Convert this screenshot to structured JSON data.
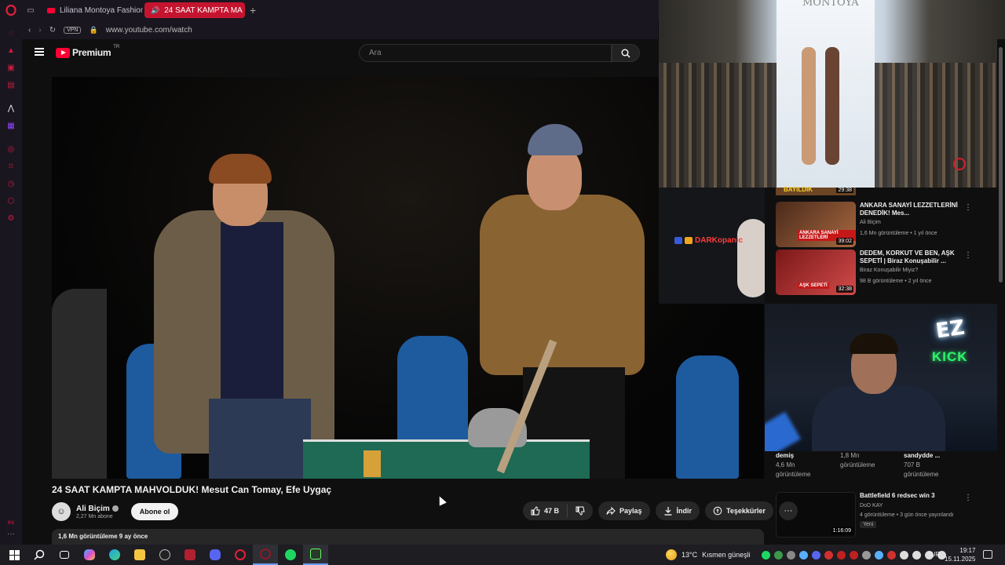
{
  "browser": {
    "tabs": [
      {
        "label": "Liliana Montoya Fashion S",
        "active": false
      },
      {
        "label": "24 SAAT KAMPTA MA",
        "active": true
      }
    ],
    "address": {
      "vpn_label": "VPN",
      "url": "www.youtube.com/watch"
    },
    "accent_color": "#c5142f"
  },
  "youtube": {
    "logo_text": "Premium",
    "logo_region": "TR",
    "search_placeholder": "Ara"
  },
  "video": {
    "title": "24 SAAT KAMPTA MAHVOLDUK! Mesut Can Tomay, Efe Uygaç",
    "channel": {
      "name": "Ali Biçim",
      "subscribers": "2,27 Mn abone"
    },
    "subscribe_label": "Abone ol",
    "likes": "47 B",
    "share_label": "Paylaş",
    "download_label": "İndir",
    "thanks_label": "Teşekkürler",
    "description_meta": "1,6 Mn görüntüleme  9 ay önce"
  },
  "pip": {
    "runway_brand": "MONTOYA",
    "stream_user": "DARKopanic",
    "ez_sign": "EZ",
    "kick_sign": "KICK"
  },
  "recommendations": {
    "partial_top": {
      "thumb_caption": "BAYILDIK",
      "duration": "29:38"
    },
    "items": [
      {
        "title": "ANKARA SANAYİ LEZZETLERİNİ DENEDİK! Mes...",
        "channel": "Ali Biçim",
        "meta": "1,6 Mn görüntüleme • 1 yıl önce",
        "duration": "39:02",
        "thumb_caption": "ANKARA SANAYİ LEZZETLERİ"
      },
      {
        "title": "DEDEM, KORKUT VE BEN, AŞK SEPETİ | Biraz Konuşabilir ...",
        "channel": "Biraz Konuşabilir Miyiz?",
        "meta": "98 B görüntüleme • 2 yıl önce",
        "duration": "32:38",
        "thumb_caption": "AŞK SEPETİ"
      }
    ],
    "row_stats": [
      {
        "top": "demiş",
        "views": "4,6 Mn",
        "label": "görüntüleme"
      },
      {
        "top": "",
        "views": "1,8 Mn",
        "label": "görüntüleme"
      },
      {
        "top": "sandydde ...",
        "views": "707 B",
        "label": "görüntüleme"
      }
    ],
    "bottom_item": {
      "title": "Battlefield 6 redsec win 3",
      "channel": "DoD KAY",
      "meta": "4 görüntüleme • 3 gün önce yayınlandı",
      "badge": "Yeni",
      "duration": "1:16:09"
    }
  },
  "taskbar": {
    "weather_temp": "13°C",
    "weather_desc": "Kısmen güneşli",
    "lang": "TUR",
    "time": "19:17",
    "date": "15.11.2025"
  }
}
